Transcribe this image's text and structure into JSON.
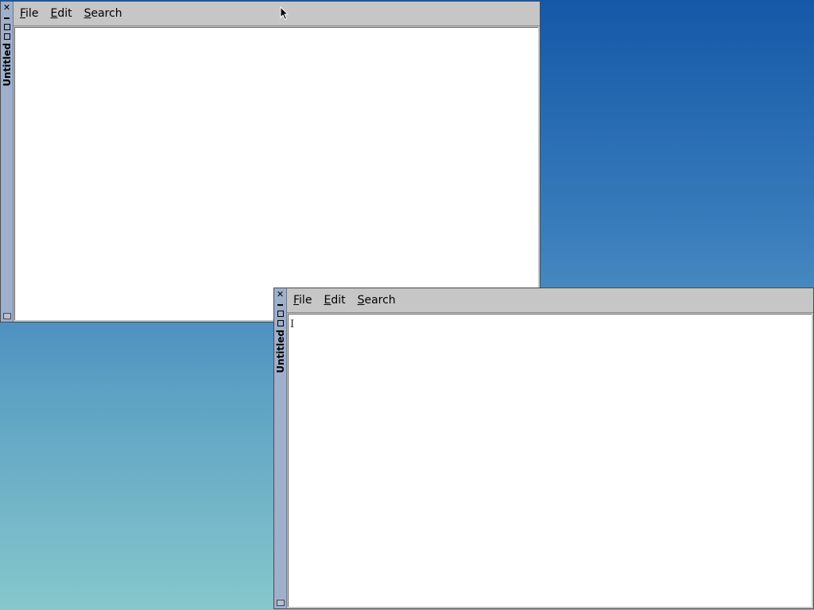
{
  "windows": [
    {
      "title": "Untitled",
      "menu": {
        "file": "File",
        "edit": "Edit",
        "search": "Search"
      },
      "content": ""
    },
    {
      "title": "Untitled",
      "menu": {
        "file": "File",
        "edit": "Edit",
        "search": "Search"
      },
      "content": "",
      "focused": true
    }
  ],
  "icons": {
    "close": "close-icon",
    "minimize": "minimize-icon",
    "maximize": "maximize-icon",
    "resize": "resize-grip-icon",
    "pointer": "mouse-pointer-icon",
    "text_cursor": "text-cursor-icon"
  },
  "colors": {
    "desktop_top": "#1458a8",
    "desktop_bottom": "#86c8cc",
    "titlebar": "#9fb0cc",
    "menubar": "#c6c6c6",
    "text_area": "#ffffff"
  }
}
